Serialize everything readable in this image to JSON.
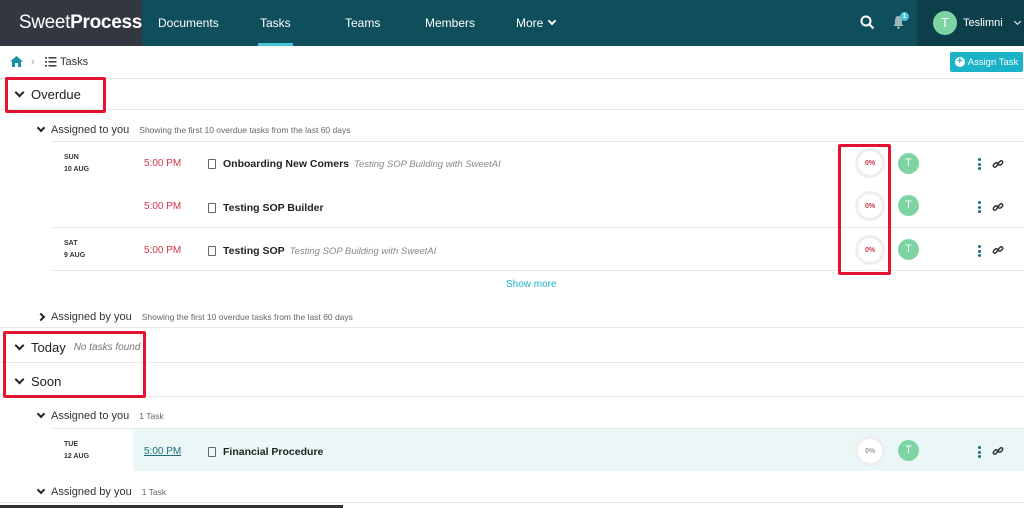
{
  "brand": {
    "name_light": "Sweet",
    "name_bold": "Process"
  },
  "nav": {
    "documents": "Documents",
    "tasks": "Tasks",
    "teams": "Teams",
    "members": "Members",
    "more": "More"
  },
  "notifications": {
    "badge": "1"
  },
  "user": {
    "initial": "T",
    "name": "Teslimni"
  },
  "breadcrumb": {
    "current": "Tasks"
  },
  "assign_button": "Assign Task",
  "overdue": {
    "title": "Overdue",
    "assigned_to_you": {
      "label": "Assigned to you",
      "note": "Showing the first 10 overdue tasks from the last 60 days",
      "tasks": [
        {
          "day": "SUN",
          "date": "10 AUG",
          "time": "5:00 PM",
          "name": "Onboarding New Comers",
          "desc": "Testing SOP Building with SweetAI",
          "progress": "0%",
          "avatar": "T"
        },
        {
          "day": "",
          "date": "",
          "time": "5:00 PM",
          "name": "Testing SOP Builder",
          "desc": "",
          "progress": "0%",
          "avatar": "T"
        },
        {
          "day": "SAT",
          "date": "9 AUG",
          "time": "5:00 PM",
          "name": "Testing SOP",
          "desc": "Testing SOP Building with SweetAI",
          "progress": "0%",
          "avatar": "T"
        }
      ],
      "show_more": "Show more"
    },
    "assigned_by_you": {
      "label": "Assigned by you",
      "note": "Showing the first 10 overdue tasks from the last 60 days"
    }
  },
  "today": {
    "title": "Today",
    "empty": "No tasks found"
  },
  "soon": {
    "title": "Soon",
    "assigned_to_you": {
      "label": "Assigned to you",
      "note": "1 Task",
      "tasks": [
        {
          "day": "TUE",
          "date": "12 AUG",
          "time": "5:00 PM",
          "name": "Financial Procedure",
          "progress": "0%",
          "avatar": "T"
        }
      ]
    },
    "assigned_by_you": {
      "label": "Assigned by you",
      "note": "1 Task"
    }
  },
  "colors": {
    "nav_bg": "#0f4f5c",
    "accent": "#1ab3c7",
    "overdue": "#d0364a",
    "annotation": "#e3122e"
  }
}
